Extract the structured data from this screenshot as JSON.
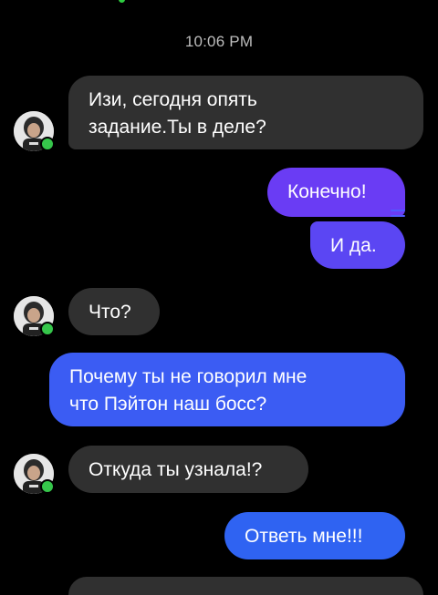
{
  "status": {
    "time": "10:06 PM"
  },
  "colors": {
    "background": "#000000",
    "incoming_bubble": "#303030",
    "outgoing_purple": "#6b3cf5",
    "outgoing_blue": "#2f63f2",
    "online": "#36c64b"
  },
  "messages": [
    {
      "sender": "contact",
      "text": "Изи, сегодня опять\nзадание.Ты в деле?"
    },
    {
      "sender": "me",
      "text": "Конечно!"
    },
    {
      "sender": "me",
      "text": "И да."
    },
    {
      "sender": "contact",
      "text": "Что?"
    },
    {
      "sender": "me",
      "text": "Почему ты не говорил мне\nчто Пэйтон наш босс?"
    },
    {
      "sender": "contact",
      "text": "Откуда ты узнала!?"
    },
    {
      "sender": "me",
      "text": "Ответь мне!!!"
    }
  ],
  "icons": {
    "avatar": "contact-avatar-icon",
    "online": "online-status-icon"
  }
}
